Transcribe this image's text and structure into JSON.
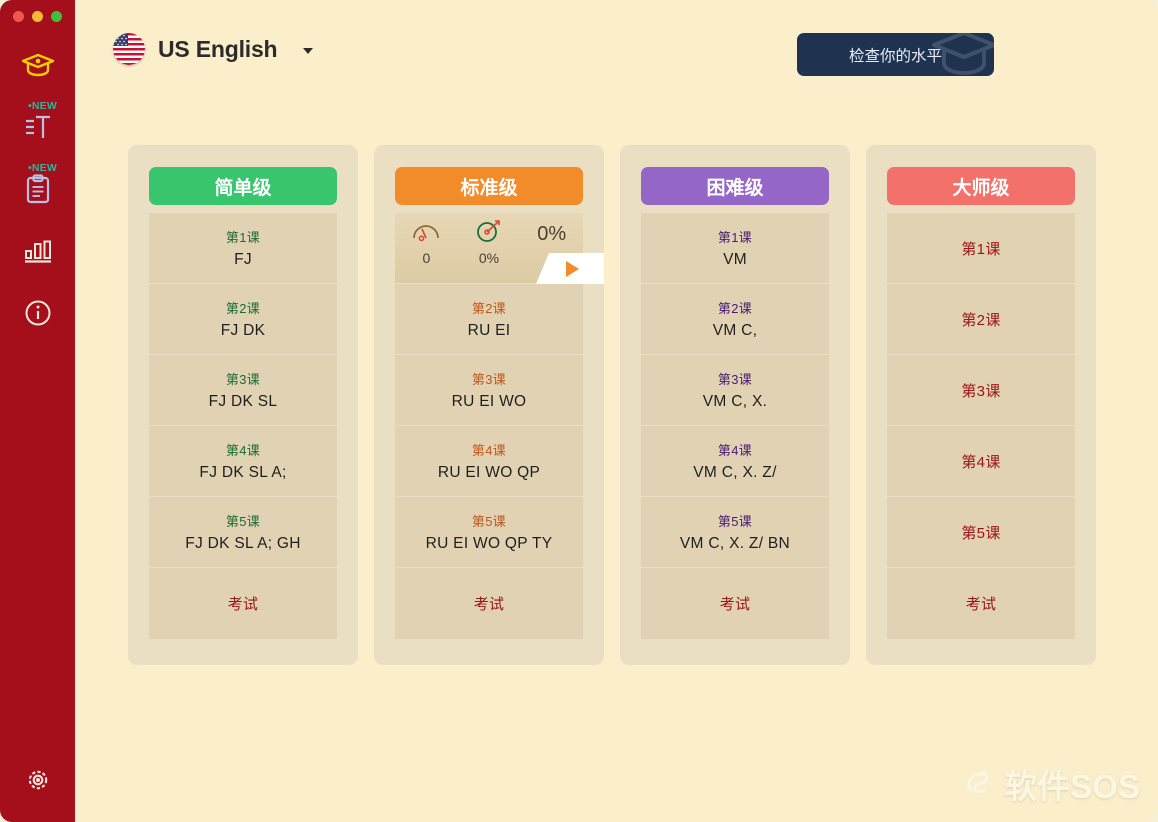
{
  "window": {
    "traffic_lights": [
      "close",
      "minimize",
      "maximize"
    ],
    "sidebar_color": "#a50f1b",
    "background_color": "#faeecb"
  },
  "sidebar": {
    "items": [
      {
        "id": "lessons",
        "icon": "graduation-cap-icon",
        "badge": ""
      },
      {
        "id": "text-practice",
        "icon": "text-cursor-icon",
        "badge": "NEW"
      },
      {
        "id": "clipboard-tests",
        "icon": "clipboard-icon",
        "badge": "NEW"
      },
      {
        "id": "statistics",
        "icon": "bar-chart-icon",
        "badge": ""
      },
      {
        "id": "info",
        "icon": "info-circle-icon",
        "badge": ""
      }
    ],
    "settings": {
      "id": "settings",
      "icon": "gear-icon"
    }
  },
  "header": {
    "language": {
      "flag": "us-flag-icon",
      "name": "US English",
      "caret": "chevron-down-icon"
    },
    "level_check_button": {
      "label": "检查你的水平",
      "color": "#1f3350"
    }
  },
  "columns": [
    {
      "id": "easy",
      "title": "简单级",
      "title_color": "#39c46e",
      "label_color": "#1d6b34",
      "lessons": [
        {
          "num": "第1课",
          "keys": "FJ"
        },
        {
          "num": "第2课",
          "keys": "FJ DK"
        },
        {
          "num": "第3课",
          "keys": "FJ DK SL"
        },
        {
          "num": "第4课",
          "keys": "FJ DK SL A;"
        },
        {
          "num": "第5课",
          "keys": "FJ DK SL A; GH"
        }
      ],
      "exam": {
        "label": "考试"
      }
    },
    {
      "id": "standard",
      "title": "标准级",
      "title_color": "#f28b2a",
      "label_color": "#c0571b",
      "active_lesson": {
        "speed_icon": "speed-gauge-icon",
        "speed_value": "0",
        "accuracy_icon": "accuracy-target-icon",
        "accuracy_value": "0%",
        "progress_value": "0%",
        "play_icon": "play-icon"
      },
      "lessons": [
        {
          "num": "第2课",
          "keys": "RU EI"
        },
        {
          "num": "第3课",
          "keys": "RU EI WO"
        },
        {
          "num": "第4课",
          "keys": "RU EI WO QP"
        },
        {
          "num": "第5课",
          "keys": "RU EI WO QP TY"
        }
      ],
      "exam": {
        "label": "考试"
      }
    },
    {
      "id": "hard",
      "title": "困难级",
      "title_color": "#9466c8",
      "label_color": "#4a1a73",
      "lessons": [
        {
          "num": "第1课",
          "keys": "VM"
        },
        {
          "num": "第2课",
          "keys": "VM C,"
        },
        {
          "num": "第3课",
          "keys": "VM C, X."
        },
        {
          "num": "第4课",
          "keys": "VM C, X. Z/"
        },
        {
          "num": "第5课",
          "keys": "VM C, X. Z/ BN"
        }
      ],
      "exam": {
        "label": "考试"
      }
    },
    {
      "id": "master",
      "title": "大师级",
      "title_color": "#f2726b",
      "label_color": "#9c1318",
      "lessons": [
        {
          "num": "第1课",
          "keys": ""
        },
        {
          "num": "第2课",
          "keys": ""
        },
        {
          "num": "第3课",
          "keys": ""
        },
        {
          "num": "第4课",
          "keys": ""
        },
        {
          "num": "第5课",
          "keys": ""
        }
      ],
      "exam": {
        "label": "考试"
      }
    }
  ],
  "watermark": {
    "text": "软件SOS",
    "icon": "sos-logo-icon"
  }
}
